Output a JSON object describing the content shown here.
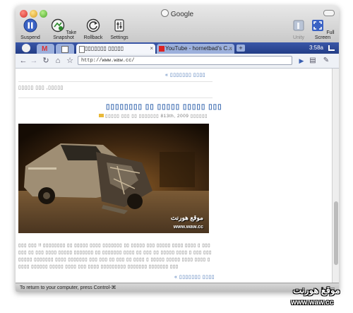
{
  "window": {
    "title": "Google"
  },
  "toolbar": [
    {
      "label": "Suspend",
      "icon": "pause-icon"
    },
    {
      "label": "Take Snapshot",
      "icon": "snapshot-icon"
    },
    {
      "label": "Rollback",
      "icon": "rollback-icon"
    },
    {
      "label": "Settings",
      "icon": "settings-icon"
    },
    {
      "label": "Unity",
      "icon": "unity-icon"
    },
    {
      "label": "Full Screen",
      "icon": "fullscreen-icon"
    }
  ],
  "tabs": [
    {
      "label": "",
      "icon": "gmail-icon"
    },
    {
      "label": "",
      "icon": "page-icon"
    },
    {
      "label": "▯▯▯▯▯▯▯ ▯▯▯▯▯",
      "icon": "page-icon"
    },
    {
      "label": "YouTube - hornetbad's C...",
      "icon": "youtube-icon"
    }
  ],
  "tab_time": "3:58a",
  "address_bar": {
    "url": "http://www.waw.cc/"
  },
  "page": {
    "top_link": "« ▯▯▯▯▯▯▯ ▯▯▯▯",
    "muted_text": "▯▯▯▯▯ ▯▯▯ ,▯▯▯▯▯",
    "post_title": "▯▯▯▯▯▯▯▯ ▯▯ ▯▯▯▯▯ ▯▯▯▯▯ ▯▯▯",
    "post_meta": "▯▯▯▯▯ ▯▯▯ ▯▯   ▯▯▯▯▯▯▯ 813th, 2009 ▯▯▯▯▯▯",
    "image_watermark_ar": "موقع هورنت",
    "image_watermark_url": "www.waw.cc",
    "paragraph": "▯▯▯ ▯▯▯ !! ▯▯▯▯▯▯▯▯ ▯▯ ▯▯▯▯▯ ▯▯▯▯ ▯▯▯▯▯▯▯ ▯▯ ▯▯▯▯▯ ▯▯▯ ▯▯▯▯▯ ▯▯▯▯ ▯▯▯▯ ▯ ▯▯▯▯▯▯ ▯▯ ▯▯▯ ▯▯▯▯ ▯▯▯▯▯ ▯▯▯▯▯▯▯ ▯▯ ▯▯▯▯▯▯▯ ▯▯▯▯ ▯▯ ▯▯▯ ▯▯ ▯▯▯▯▯ ▯▯▯▯ ▯ ▯▯▯ ▯▯▯▯▯▯▯▯ ▯▯▯▯▯▯▯ ▯▯▯▯ ▯▯▯▯▯▯▯ ▯▯▯ ▯▯▯ ▯▯ ▯▯▯ ▯▯ ▯▯▯▯ ▯ ▯▯▯▯▯ ▯▯▯▯▯ ▯▯▯▯ ▯▯▯▯ ▯▯▯▯▯ ▯▯▯▯▯▯ ▯▯▯▯▯ ▯▯▯▯ ▯▯▯ ▯▯▯▯ ▯▯▯▯▯▯▯▯▯ ▯▯▯▯▯▯▯ ▯▯▯▯▯▯▯ ▯▯▯",
    "more_link": "« ▯▯▯▯▯▯▯ ▯▯▯▯"
  },
  "status_bar": {
    "text": "To return to your computer, press Control-⌘"
  },
  "outer_watermark": {
    "arabic": "موقع هورنت",
    "url": "www.waw.cc"
  }
}
